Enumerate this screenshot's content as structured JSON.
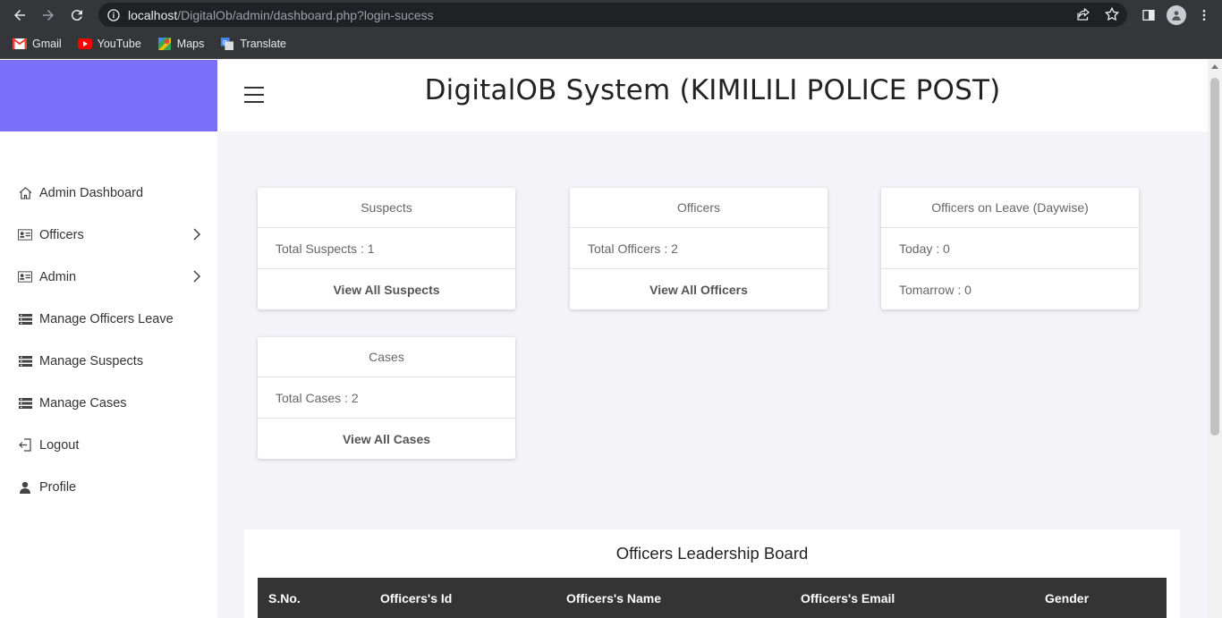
{
  "browser": {
    "url_host": "localhost",
    "url_path": "/DigitalOb/admin/dashboard.php?login-sucess",
    "bookmarks": [
      {
        "label": "Gmail",
        "icon": "gmail-icon"
      },
      {
        "label": "YouTube",
        "icon": "youtube-icon"
      },
      {
        "label": "Maps",
        "icon": "maps-icon"
      },
      {
        "label": "Translate",
        "icon": "translate-icon"
      }
    ]
  },
  "header": {
    "title": "DigitalOB System (KIMILILI POLICE POST)"
  },
  "sidebar": {
    "brand_color": "#7a6ff8",
    "items": [
      {
        "label": "Admin Dashboard",
        "icon": "home-icon",
        "has_submenu": false
      },
      {
        "label": "Officers",
        "icon": "id-card-icon",
        "has_submenu": true
      },
      {
        "label": "Admin",
        "icon": "id-card-icon",
        "has_submenu": true
      },
      {
        "label": "Manage Officers Leave",
        "icon": "list-icon",
        "has_submenu": false
      },
      {
        "label": "Manage Suspects",
        "icon": "list-icon",
        "has_submenu": false
      },
      {
        "label": "Manage Cases",
        "icon": "list-icon",
        "has_submenu": false
      },
      {
        "label": "Logout",
        "icon": "logout-icon",
        "has_submenu": false
      },
      {
        "label": "Profile",
        "icon": "user-icon",
        "has_submenu": false
      }
    ]
  },
  "cards": {
    "suspects": {
      "title": "Suspects",
      "body": "Total Suspects : 1",
      "link": "View All Suspects"
    },
    "officers": {
      "title": "Officers",
      "body": "Total Officers : 2",
      "link": "View All Officers"
    },
    "leave": {
      "title": "Officers on Leave (Daywise)",
      "today": "Today : 0",
      "tomorrow": "Tomarrow : 0"
    },
    "cases": {
      "title": "Cases",
      "body": "Total Cases : 2",
      "link": "View All Cases"
    }
  },
  "leaderboard": {
    "title": "Officers Leadership Board",
    "columns": [
      "S.No.",
      "Officers's Id",
      "Officers's Name",
      "Officers's Email",
      "Gender"
    ]
  }
}
